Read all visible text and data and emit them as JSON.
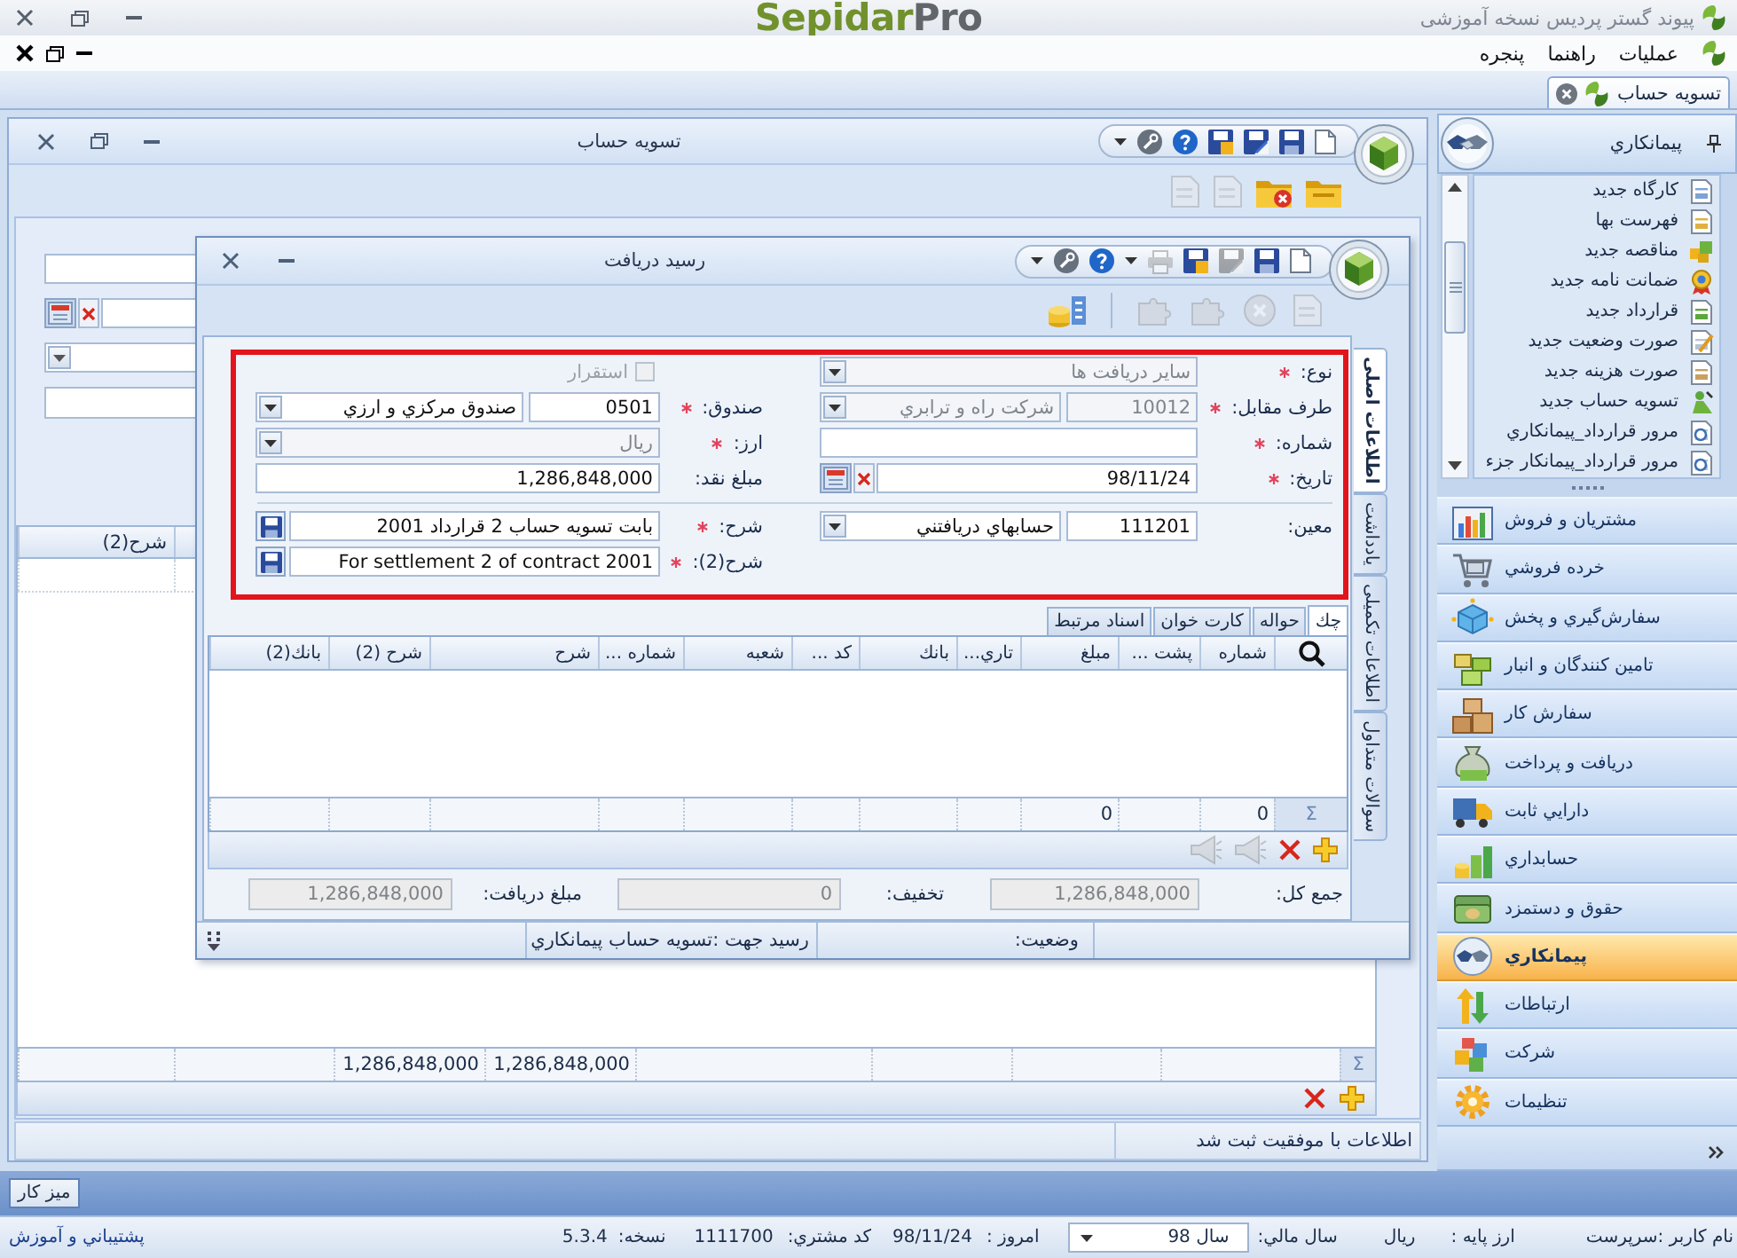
{
  "app_bar": {
    "title": "پیوند گستر پردیس نسخه آموزشی",
    "logo": {
      "primary": "Sepidar",
      "secondary": "Pro"
    }
  },
  "menu": [
    {
      "label": "عملیات"
    },
    {
      "label": "راهنما"
    },
    {
      "label": "پنجره"
    }
  ],
  "document_tabs": [
    {
      "label": "تسویه حساب",
      "selected": true
    }
  ],
  "background_window": {
    "title": "تسویه حساب",
    "toolbar": [
      {
        "disabled": false
      },
      {
        "disabled": false
      },
      {
        "disabled": true
      },
      {
        "disabled": true
      }
    ],
    "grid": {
      "sum_symbol": "Σ",
      "columns": [
        {},
        {},
        {},
        {},
        {
          "total": "1,286,848,000"
        },
        {
          "total": "1,286,848,000"
        },
        {},
        {
          "label": "شرح(2)"
        }
      ]
    },
    "status_message": "اطلاعات با موفقیت ثبت شد"
  },
  "dialog": {
    "title": "رسید دریافت",
    "quick_access": [
      {
        "disabled": false
      },
      {
        "disabled": false
      },
      {
        "disabled": true
      },
      {
        "disabled": false
      },
      {
        "disabled": true
      },
      {
        "disabled": false
      },
      {
        "disabled": false
      }
    ],
    "toolbar": [
      {
        "disabled": true
      },
      {
        "disabled": true
      },
      {
        "disabled": true
      },
      {
        "disabled": true
      },
      {
        "disabled": false
      }
    ],
    "form": {
      "sections": [
        {
          "rows": [
            {
              "right": {
                "kind": "select",
                "label": "نوع:",
                "required": true,
                "value": "سایر دریافت ها",
                "disabled": true
              },
              "left": {
                "kind": "checkbox",
                "label": "استقرار",
                "checked": false,
                "disabled": true
              }
            },
            {
              "right": {
                "kind": "lookup",
                "label": "طرف مقابل:",
                "required": true,
                "code": "10012",
                "value": "شرکت راه و ترابري",
                "disabled": true
              },
              "left": {
                "kind": "lookup",
                "label": "صندوق:",
                "required": true,
                "code": "0501",
                "value": "صندوق مرکزي و ارزي",
                "disabled": false
              }
            },
            {
              "right": {
                "kind": "text",
                "label": "شماره:",
                "required": true,
                "disabled": false
              },
              "left": {
                "kind": "select",
                "label": "ارز:",
                "required": true,
                "value": "ريال",
                "disabled": true
              }
            },
            {
              "right": {
                "kind": "date",
                "label": "تاریخ:",
                "required": true,
                "value": "98/11/24",
                "disabled": false
              },
              "left": {
                "kind": "text",
                "label": "مبلغ نقد:",
                "required": false,
                "value": "1,286,848,000",
                "disabled": false
              }
            }
          ]
        },
        {
          "rows": [
            {
              "right": {
                "kind": "lookup",
                "label": "معین:",
                "required": false,
                "code": "111201",
                "value": "حسابهاي دريافتني",
                "disabled": false
              },
              "left": {
                "kind": "memo",
                "label": "شرح:",
                "required": true,
                "value": "بابت تسويه حساب 2 قرارداد 2001",
                "disabled": false
              }
            },
            {
              "left": {
                "kind": "memo",
                "label": "شرح(2):",
                "required": true,
                "value": "For settlement 2 of contract 2001",
                "disabled": false
              }
            }
          ]
        }
      ]
    },
    "grid_tabs": [
      {
        "label": "چك",
        "selected": true
      },
      {
        "label": "حواله",
        "selected": false
      },
      {
        "label": "كارت خوان",
        "selected": false
      },
      {
        "label": "اسناد مرتبط",
        "selected": false
      }
    ],
    "grid": {
      "sum_symbol": "Σ",
      "columns": [
        {
          "label": "شماره",
          "total": "0"
        },
        {
          "label": "پشت ..."
        },
        {
          "label": "مبلغ",
          "total": "0"
        },
        {
          "label": "تاري..."
        },
        {
          "label": "بانك"
        },
        {
          "label": "کد ..."
        },
        {
          "label": "شعبه"
        },
        {
          "label": "شماره ..."
        },
        {
          "label": "شرح"
        },
        {
          "label": "شرح (2)"
        },
        {
          "label": "بانك(2)"
        }
      ]
    },
    "grid_toolbar": [
      {
        "disabled": false
      },
      {
        "disabled": false
      },
      {
        "disabled": true
      },
      {
        "disabled": true
      }
    ],
    "totals": [
      {
        "label": "جمع کل:",
        "value": "1,286,848,000",
        "disabled": true
      },
      {
        "label": "تخفیف:",
        "value": "0",
        "disabled": true
      },
      {
        "label": "مبلغ دریافت:",
        "value": "1,286,848,000",
        "disabled": true
      }
    ],
    "status": {
      "label": "وضعیت:",
      "value": "رسید جهت :تسویه حساب پیمانکاري"
    },
    "side_tabs": [
      {
        "label": "اطلاعات اصلی",
        "selected": true
      },
      {
        "label": "یادداشت",
        "selected": false
      },
      {
        "label": "اطلاعات تکمیلی",
        "selected": false
      },
      {
        "label": "سوالات متداول",
        "selected": false
      }
    ]
  },
  "sidebar": {
    "title": "پیمانکاري",
    "shortcuts": [
      {
        "label": "کارگاه جدید"
      },
      {
        "label": "فهرست بها"
      },
      {
        "label": "مناقصه جدید"
      },
      {
        "label": "ضمانت نامه جدید"
      },
      {
        "label": "قرارداد جدید"
      },
      {
        "label": "صورت وضعیت جدید"
      },
      {
        "label": "صورت هزینه جدید"
      },
      {
        "label": "تسویه حساب جدید"
      },
      {
        "label": "مرور قرارداد_پیمانکاري"
      },
      {
        "label": "مرور قرارداد_پیمانکار جزء"
      }
    ],
    "modules": [
      {
        "label": "مشتريان و فروش",
        "selected": false
      },
      {
        "label": "خرده فروشي",
        "selected": false
      },
      {
        "label": "سفارش‌گيري و پخش",
        "selected": false
      },
      {
        "label": "تامين كنندگان و انبار",
        "selected": false
      },
      {
        "label": "سفارش كار",
        "selected": false
      },
      {
        "label": "دريافت و پرداخت",
        "selected": false
      },
      {
        "label": "دارايي ثابت",
        "selected": false
      },
      {
        "label": "حسابداري",
        "selected": false
      },
      {
        "label": "حقوق و دستمزد",
        "selected": false
      },
      {
        "label": "پیمانکاري",
        "selected": true
      },
      {
        "label": "ارتباطات",
        "selected": false
      },
      {
        "label": "شركت",
        "selected": false
      },
      {
        "label": "تنظيمات",
        "selected": false
      }
    ]
  },
  "taskbar": {
    "buttons": [
      {
        "label": "میز کار"
      }
    ]
  },
  "status_bar": {
    "user": "نام کاربر :سرپرست",
    "base_currency_label": "ارز پایه :",
    "base_currency": "ریال",
    "fiscal_year_label": "سال مالي:",
    "fiscal_year": "سال 98",
    "today_label": "امروز :",
    "today": "98/11/24",
    "customer_code_label": "کد مشتري:",
    "customer_code": "1111700",
    "version_label": "نسخه:",
    "version": "5.3.4",
    "support_link": "پشتیباني و آموزش"
  }
}
